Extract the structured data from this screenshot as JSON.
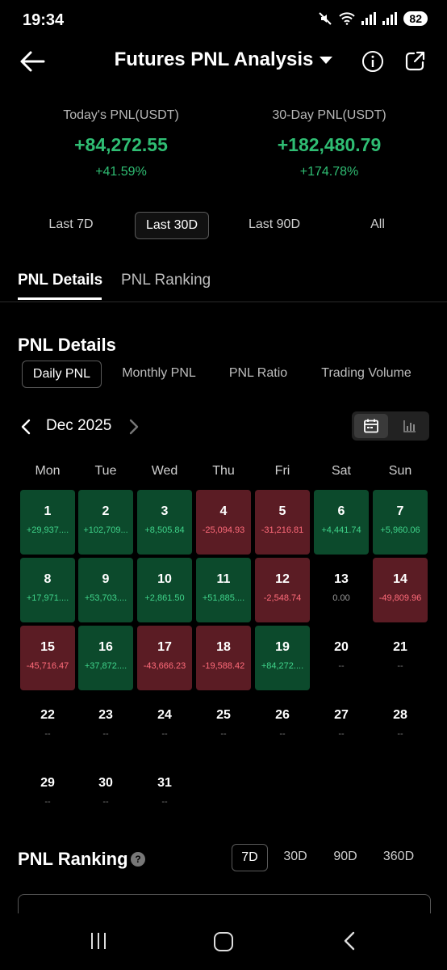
{
  "status": {
    "time": "19:34",
    "battery": "82"
  },
  "header": {
    "title": "Futures PNL Analysis"
  },
  "summary": {
    "today_label": "Today's PNL(USDT)",
    "today_value": "+84,272.55",
    "today_pct": "+41.59%",
    "month_label": "30-Day PNL(USDT)",
    "month_value": "+182,480.79",
    "month_pct": "+174.78%"
  },
  "ranges": [
    "Last 7D",
    "Last 30D",
    "Last 90D",
    "All"
  ],
  "main_tabs": [
    "PNL Details",
    "PNL Ranking"
  ],
  "details": {
    "title": "PNL Details",
    "sub_tabs": [
      "Daily PNL",
      "Monthly PNL",
      "PNL Ratio",
      "Trading Volume"
    ],
    "month": "Dec 2025",
    "weekdays": [
      "Mon",
      "Tue",
      "Wed",
      "Thu",
      "Fri",
      "Sat",
      "Sun"
    ],
    "days": [
      {
        "d": "1",
        "v": "+29,937....",
        "s": "pos"
      },
      {
        "d": "2",
        "v": "+102,709...",
        "s": "pos"
      },
      {
        "d": "3",
        "v": "+8,505.84",
        "s": "pos"
      },
      {
        "d": "4",
        "v": "-25,094.93",
        "s": "neg"
      },
      {
        "d": "5",
        "v": "-31,216.81",
        "s": "neg"
      },
      {
        "d": "6",
        "v": "+4,441.74",
        "s": "pos"
      },
      {
        "d": "7",
        "v": "+5,960.06",
        "s": "pos"
      },
      {
        "d": "8",
        "v": "+17,971....",
        "s": "pos"
      },
      {
        "d": "9",
        "v": "+53,703....",
        "s": "pos"
      },
      {
        "d": "10",
        "v": "+2,861.50",
        "s": "pos"
      },
      {
        "d": "11",
        "v": "+51,885....",
        "s": "pos"
      },
      {
        "d": "12",
        "v": "-2,548.74",
        "s": "neg"
      },
      {
        "d": "13",
        "v": "0.00",
        "s": "zero"
      },
      {
        "d": "14",
        "v": "-49,809.96",
        "s": "neg"
      },
      {
        "d": "15",
        "v": "-45,716.47",
        "s": "neg"
      },
      {
        "d": "16",
        "v": "+37,872....",
        "s": "pos"
      },
      {
        "d": "17",
        "v": "-43,666.23",
        "s": "neg"
      },
      {
        "d": "18",
        "v": "-19,588.42",
        "s": "neg"
      },
      {
        "d": "19",
        "v": "+84,272....",
        "s": "pos"
      },
      {
        "d": "20",
        "v": "--",
        "s": "empty"
      },
      {
        "d": "21",
        "v": "--",
        "s": "empty"
      },
      {
        "d": "22",
        "v": "--",
        "s": "empty"
      },
      {
        "d": "23",
        "v": "--",
        "s": "empty"
      },
      {
        "d": "24",
        "v": "--",
        "s": "empty"
      },
      {
        "d": "25",
        "v": "--",
        "s": "empty"
      },
      {
        "d": "26",
        "v": "--",
        "s": "empty"
      },
      {
        "d": "27",
        "v": "--",
        "s": "empty"
      },
      {
        "d": "28",
        "v": "--",
        "s": "empty"
      },
      {
        "d": "29",
        "v": "--",
        "s": "empty"
      },
      {
        "d": "30",
        "v": "--",
        "s": "empty"
      },
      {
        "d": "31",
        "v": "--",
        "s": "empty"
      }
    ]
  },
  "ranking": {
    "title": "PNL Ranking",
    "help": "?",
    "tabs": [
      "7D",
      "30D",
      "90D",
      "360D"
    ]
  },
  "colors": {
    "positive": "#2fbd73",
    "negative": "#ff6b7a",
    "positive_cell": "#0c4a2c",
    "negative_cell": "#5b1c24"
  }
}
